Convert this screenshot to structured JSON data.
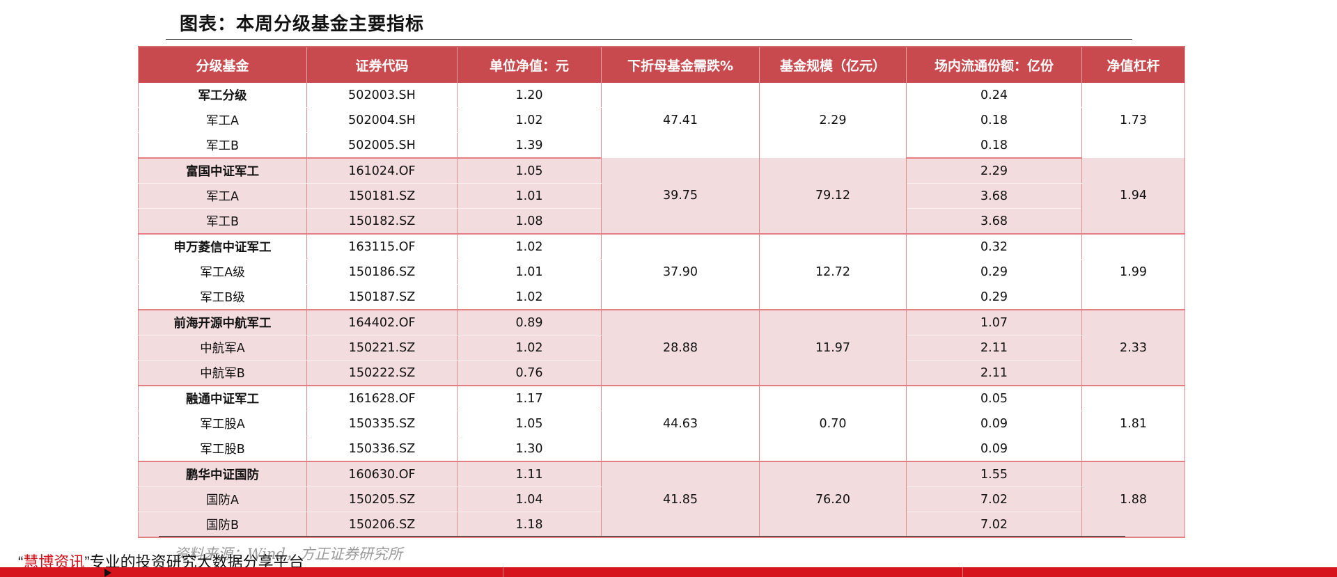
{
  "title": "图表：本周分级基金主要指标",
  "columns": [
    "分级基金",
    "证券代码",
    "单位净值：元",
    "下折母基金需跌%",
    "基金规模（亿元）",
    "场内流通份额：亿份",
    "净值杠杆"
  ],
  "groups": [
    {
      "drop": "47.41",
      "scale": "2.29",
      "leverage": "1.73",
      "rows": [
        {
          "name": "军工分级",
          "code": "502003.SH",
          "nav": "1.20",
          "float": "0.24"
        },
        {
          "name": "军工A",
          "code": "502004.SH",
          "nav": "1.02",
          "float": "0.18"
        },
        {
          "name": "军工B",
          "code": "502005.SH",
          "nav": "1.39",
          "float": "0.18"
        }
      ]
    },
    {
      "drop": "39.75",
      "scale": "79.12",
      "leverage": "1.94",
      "rows": [
        {
          "name": "富国中证军工",
          "code": "161024.OF",
          "nav": "1.05",
          "float": "2.29"
        },
        {
          "name": "军工A",
          "code": "150181.SZ",
          "nav": "1.01",
          "float": "3.68"
        },
        {
          "name": "军工B",
          "code": "150182.SZ",
          "nav": "1.08",
          "float": "3.68"
        }
      ]
    },
    {
      "drop": "37.90",
      "scale": "12.72",
      "leverage": "1.99",
      "rows": [
        {
          "name": "申万菱信中证军工",
          "code": "163115.OF",
          "nav": "1.02",
          "float": "0.32"
        },
        {
          "name": "军工A级",
          "code": "150186.SZ",
          "nav": "1.01",
          "float": "0.29"
        },
        {
          "name": "军工B级",
          "code": "150187.SZ",
          "nav": "1.02",
          "float": "0.29"
        }
      ]
    },
    {
      "drop": "28.88",
      "scale": "11.97",
      "leverage": "2.33",
      "rows": [
        {
          "name": "前海开源中航军工",
          "code": "164402.OF",
          "nav": "0.89",
          "float": "1.07"
        },
        {
          "name": "中航军A",
          "code": "150221.SZ",
          "nav": "1.02",
          "float": "2.11"
        },
        {
          "name": "中航军B",
          "code": "150222.SZ",
          "nav": "0.76",
          "float": "2.11"
        }
      ]
    },
    {
      "drop": "44.63",
      "scale": "0.70",
      "leverage": "1.81",
      "rows": [
        {
          "name": "融通中证军工",
          "code": "161628.OF",
          "nav": "1.17",
          "float": "0.05"
        },
        {
          "name": "军工股A",
          "code": "150335.SZ",
          "nav": "1.05",
          "float": "0.09"
        },
        {
          "name": "军工股B",
          "code": "150336.SZ",
          "nav": "1.30",
          "float": "0.09"
        }
      ]
    },
    {
      "drop": "41.85",
      "scale": "76.20",
      "leverage": "1.88",
      "rows": [
        {
          "name": "鹏华中证国防",
          "code": "160630.OF",
          "nav": "1.11",
          "float": "1.55"
        },
        {
          "name": "国防A",
          "code": "150205.SZ",
          "nav": "1.04",
          "float": "7.02"
        },
        {
          "name": "国防B",
          "code": "150206.SZ",
          "nav": "1.18",
          "float": "7.02"
        }
      ]
    }
  ],
  "source": "资料来源：Wind，方正证券研究所",
  "promo": {
    "open_quote": "“",
    "brand": "慧博资讯",
    "close_quote": "”",
    "text": "专业的投资研究大数据分享平台"
  },
  "colors": {
    "header_bg": "#c94a4e",
    "band_pink": "#f2dcdd",
    "group_border": "#e37f82",
    "footer_bar": "#d6141d",
    "brand": "#d0121b"
  }
}
